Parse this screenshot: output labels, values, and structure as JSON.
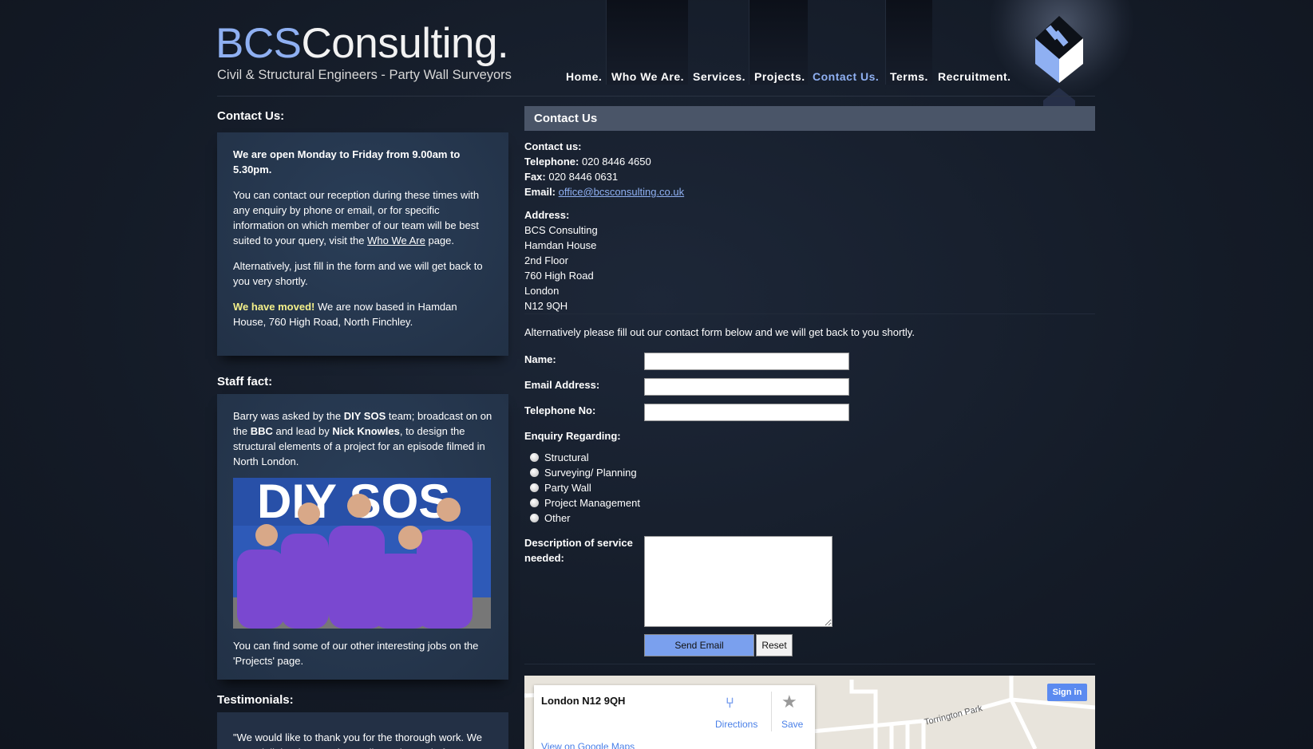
{
  "header": {
    "brand_bcs": "BCS",
    "brand_rest": "Consulting.",
    "tagline": "Civil & Structural Engineers - Party Wall Surveyors"
  },
  "nav": [
    {
      "label": "Home."
    },
    {
      "label": "Who We Are."
    },
    {
      "label": "Services."
    },
    {
      "label": "Projects."
    },
    {
      "label": "Contact Us.",
      "active": true
    },
    {
      "label": "Terms."
    },
    {
      "label": "Recruitment."
    }
  ],
  "left": {
    "contact_heading": "Contact Us:",
    "hours": "We are open Monday to Friday from 9.00am to 5.30pm.",
    "p2_before": "You can contact our reception during these times with any enquiry by phone or email, or for specific information on which member of our team will be best suited to your query, visit the ",
    "p2_link": "Who We Are",
    "p2_after": " page.",
    "p3": "Alternatively, just fill in the form and we will get back to you very shortly.",
    "moved_highlight": "We have moved!",
    "moved_text": " We are now based in Hamdan House, 760 High Road, North Finchley.",
    "staff_heading": "Staff fact:",
    "staff_1": "Barry was asked by the ",
    "staff_diy": "DIY SOS",
    "staff_2": " team; broadcast on on the ",
    "staff_bbc": "BBC",
    "staff_3": " and lead by ",
    "staff_nick": "Nick Knowles",
    "staff_4": ", to design the structural elements of a project for an episode filmed in North London.",
    "staff_footer": "You can find some of our other interesting jobs on the 'Projects' page.",
    "testimonials_heading": "Testimonials:",
    "testimonial_text": "\"We would like to thank you for the thorough work. We were delighted to see the quality and speed of"
  },
  "right": {
    "title": "Contact Us",
    "contact_label": "Contact us:",
    "tel_label": "Telephone:",
    "tel": " 020 8446 4650",
    "fax_label": "Fax:",
    "fax": " 020 8446 0631",
    "email_label": "Email:",
    "email": "office@bcsconsulting.co.uk",
    "address_label": "Address:",
    "address": [
      "BCS Consulting",
      "Hamdan House",
      "2nd Floor",
      "760 High Road",
      "London",
      "N12 9QH"
    ],
    "intro": "Alternatively please fill out our contact form below and we will get back to you shortly.",
    "form": {
      "name_label": "Name:",
      "email_label": "Email Address:",
      "phone_label": "Telephone No:",
      "enquiry_label": "Enquiry Regarding:",
      "options": [
        "Structural",
        "Surveying/ Planning",
        "Party Wall",
        "Project Management",
        "Other"
      ],
      "description_label": "Description of service needed:",
      "send": "Send Email",
      "reset": "Reset"
    },
    "map": {
      "place": "London N12 9QH",
      "directions": "Directions",
      "save": "Save",
      "view_link": "View on Google Maps",
      "sign_in": "Sign in",
      "street": "Torrington Park"
    }
  }
}
